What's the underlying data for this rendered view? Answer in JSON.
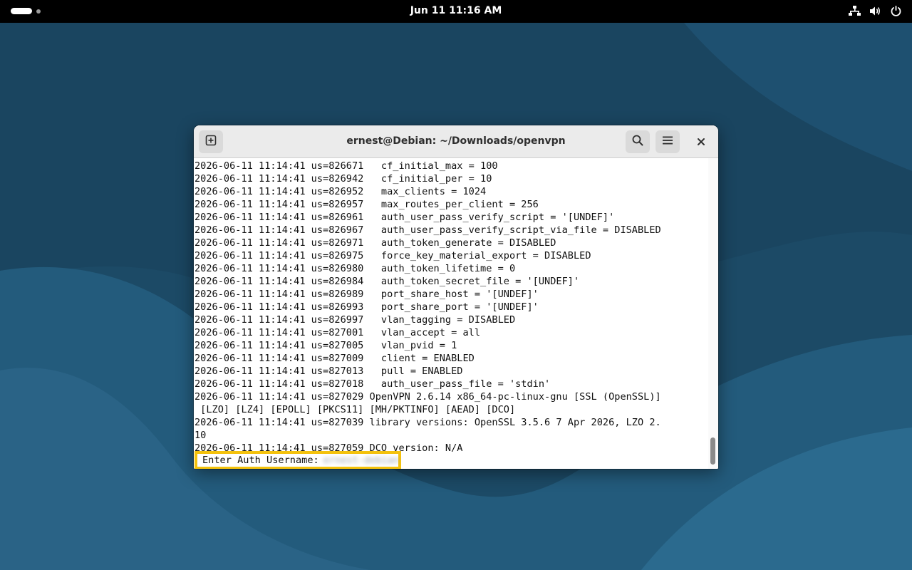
{
  "topbar": {
    "clock": "Jun 11  11:16 AM",
    "icons": [
      "network-wired-icon",
      "volume-icon",
      "power-icon"
    ]
  },
  "window": {
    "title": "ernest@Debian: ~/Downloads/openvpn",
    "buttons": {
      "new_tab": "new-tab-icon",
      "search": "search-icon",
      "menu": "hamburger-menu-icon",
      "close": "close-icon"
    }
  },
  "terminal": {
    "lines": [
      "2026-06-11 11:14:41 us=826671   cf_initial_max = 100",
      "2026-06-11 11:14:41 us=826942   cf_initial_per = 10",
      "2026-06-11 11:14:41 us=826952   max_clients = 1024",
      "2026-06-11 11:14:41 us=826957   max_routes_per_client = 256",
      "2026-06-11 11:14:41 us=826961   auth_user_pass_verify_script = '[UNDEF]'",
      "2026-06-11 11:14:41 us=826967   auth_user_pass_verify_script_via_file = DISABLED",
      "2026-06-11 11:14:41 us=826971   auth_token_generate = DISABLED",
      "2026-06-11 11:14:41 us=826975   force_key_material_export = DISABLED",
      "2026-06-11 11:14:41 us=826980   auth_token_lifetime = 0",
      "2026-06-11 11:14:41 us=826984   auth_token_secret_file = '[UNDEF]'",
      "2026-06-11 11:14:41 us=826989   port_share_host = '[UNDEF]'",
      "2026-06-11 11:14:41 us=826993   port_share_port = '[UNDEF]'",
      "2026-06-11 11:14:41 us=826997   vlan_tagging = DISABLED",
      "2026-06-11 11:14:41 us=827001   vlan_accept = all",
      "2026-06-11 11:14:41 us=827005   vlan_pvid = 1",
      "2026-06-11 11:14:41 us=827009   client = ENABLED",
      "2026-06-11 11:14:41 us=827013   pull = ENABLED",
      "2026-06-11 11:14:41 us=827018   auth_user_pass_file = 'stdin'",
      "2026-06-11 11:14:41 us=827029 OpenVPN 2.6.14 x86_64-pc-linux-gnu [SSL (OpenSSL)]",
      " [LZO] [LZ4] [EPOLL] [PKCS11] [MH/PKTINFO] [AEAD] [DCO]",
      "2026-06-11 11:14:41 us=827039 library versions: OpenSSL 3.5.6 7 Apr 2026, LZO 2.",
      "10",
      "2026-06-11 11:14:41 us=827059 DCO version: N/A"
    ],
    "prompt": "Enter Auth Username:",
    "prompt_value": "ernest-debian"
  },
  "colors": {
    "desktop_background": "#1f4e6b",
    "highlight_border": "#f4c20d"
  }
}
